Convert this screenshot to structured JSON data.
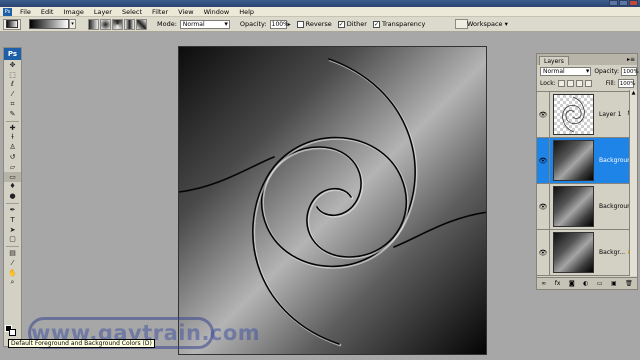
{
  "menubar": {
    "app_icon": "Ps",
    "items": [
      "File",
      "Edit",
      "Image",
      "Layer",
      "Select",
      "Filter",
      "View",
      "Window",
      "Help"
    ]
  },
  "options": {
    "mode_label": "Mode:",
    "mode_value": "Normal",
    "opacity_label": "Opacity:",
    "opacity_value": "100%",
    "reverse_label": "Reverse",
    "dither_label": "Dither",
    "transparency_label": "Transparency",
    "workspace_label": "Workspace ▾"
  },
  "toolbox": {
    "logo": "Ps",
    "tools": [
      "move-tool",
      "marquee-tool",
      "lasso-tool",
      "magic-wand-tool",
      "crop-tool",
      "slice-tool",
      "healing-brush-tool",
      "brush-tool",
      "clone-stamp-tool",
      "history-brush-tool",
      "eraser-tool",
      "gradient-tool",
      "blur-tool",
      "dodge-tool",
      "pen-tool",
      "type-tool",
      "path-selection-tool",
      "shape-tool",
      "notes-tool",
      "eyedropper-tool",
      "hand-tool",
      "zoom-tool"
    ]
  },
  "layers_panel": {
    "tab_label": "Layers",
    "menu_glyph": "▸≡",
    "blend_mode": "Normal",
    "opacity_label": "Opacity:",
    "opacity_value": "100%",
    "lock_label": "Lock:",
    "fill_label": "Fill:",
    "fill_value": "100%",
    "layers": [
      {
        "name": "Layer 1",
        "badge": "fx",
        "active": false
      },
      {
        "name": "Backgroun...",
        "badge": "",
        "active": true
      },
      {
        "name": "Background...",
        "badge": "",
        "active": false
      },
      {
        "name": "Backgr...",
        "badge": "🔒",
        "active": false
      }
    ],
    "footer_icons": [
      "link-icon",
      "fx-icon",
      "mask-icon",
      "adjustment-icon",
      "folder-icon",
      "new-layer-icon",
      "trash-icon"
    ]
  },
  "watermark": "www.gavtrain.com",
  "tooltip": "Default Foreground and Background Colors (D)",
  "colors": {
    "active_layer": "#1f84e8",
    "workspace_bg": "#a7a7a7",
    "panel_bg": "#d3d0c4"
  }
}
